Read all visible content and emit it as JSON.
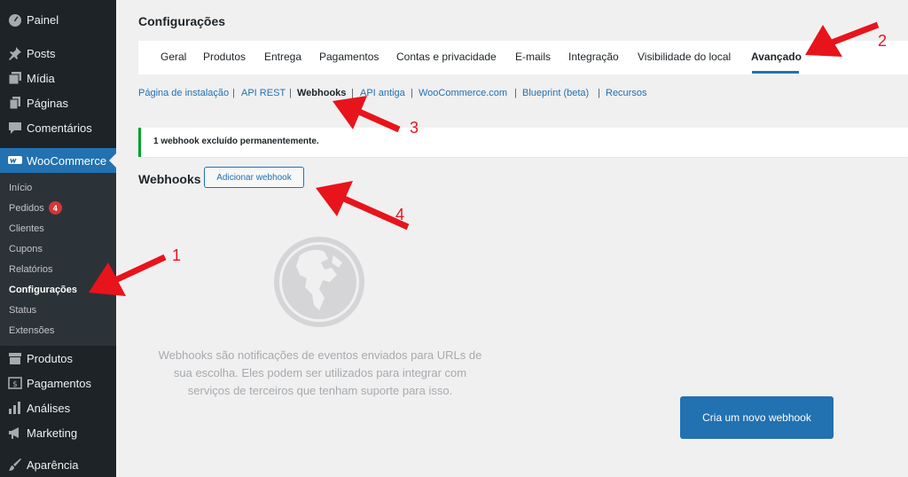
{
  "sidebar": {
    "menu": [
      {
        "label": "Painel",
        "icon": "dashboard-icon"
      },
      {
        "label": "Posts",
        "icon": "pin-icon"
      },
      {
        "label": "Mídia",
        "icon": "media-icon"
      },
      {
        "label": "Páginas",
        "icon": "pages-icon"
      },
      {
        "label": "Comentários",
        "icon": "comments-icon"
      },
      {
        "label": "WooCommerce",
        "icon": "woo-icon"
      },
      {
        "label": "Produtos",
        "icon": "archive-icon"
      },
      {
        "label": "Pagamentos",
        "icon": "payments-icon"
      },
      {
        "label": "Análises",
        "icon": "analytics-icon"
      },
      {
        "label": "Marketing",
        "icon": "megaphone-icon"
      },
      {
        "label": "Aparência",
        "icon": "brush-icon"
      }
    ],
    "submenu": [
      {
        "label": "Início"
      },
      {
        "label": "Pedidos",
        "badge": "4"
      },
      {
        "label": "Clientes"
      },
      {
        "label": "Cupons"
      },
      {
        "label": "Relatórios"
      },
      {
        "label": "Configurações"
      },
      {
        "label": "Status"
      },
      {
        "label": "Extensões"
      }
    ]
  },
  "page": {
    "title": "Configurações",
    "tabs": [
      "Geral",
      "Produtos",
      "Entrega",
      "Pagamentos",
      "Contas e privacidade",
      "E-mails",
      "Integração",
      "Visibilidade do local",
      "Avançado"
    ],
    "active_tab": "Avançado",
    "subsections": [
      "Página de instalação",
      "API REST",
      "Webhooks",
      "API antiga",
      "WooCommerce.com",
      "Blueprint (beta)",
      "Recursos"
    ],
    "active_subsection": "Webhooks",
    "separator": "|",
    "notice": "1 webhook excluído permanentemente.",
    "webhooks_heading": "Webhooks",
    "add_webhook_label": "Adicionar webhook",
    "empty_text": "Webhooks são notificações de eventos enviados para URLs de sua escolha. Eles podem ser utilizados para integrar com serviços de terceiros que tenham suporte para isso.",
    "create_button_label": "Cria um novo webhook"
  },
  "annotations": {
    "n1": "1",
    "n2": "2",
    "n3": "3",
    "n4": "4",
    "arrow_color": "#e8141b"
  },
  "colors": {
    "sidebar_bg": "#1d2327",
    "accent": "#2271b1",
    "success": "#00a32a",
    "badge": "#d63638"
  }
}
